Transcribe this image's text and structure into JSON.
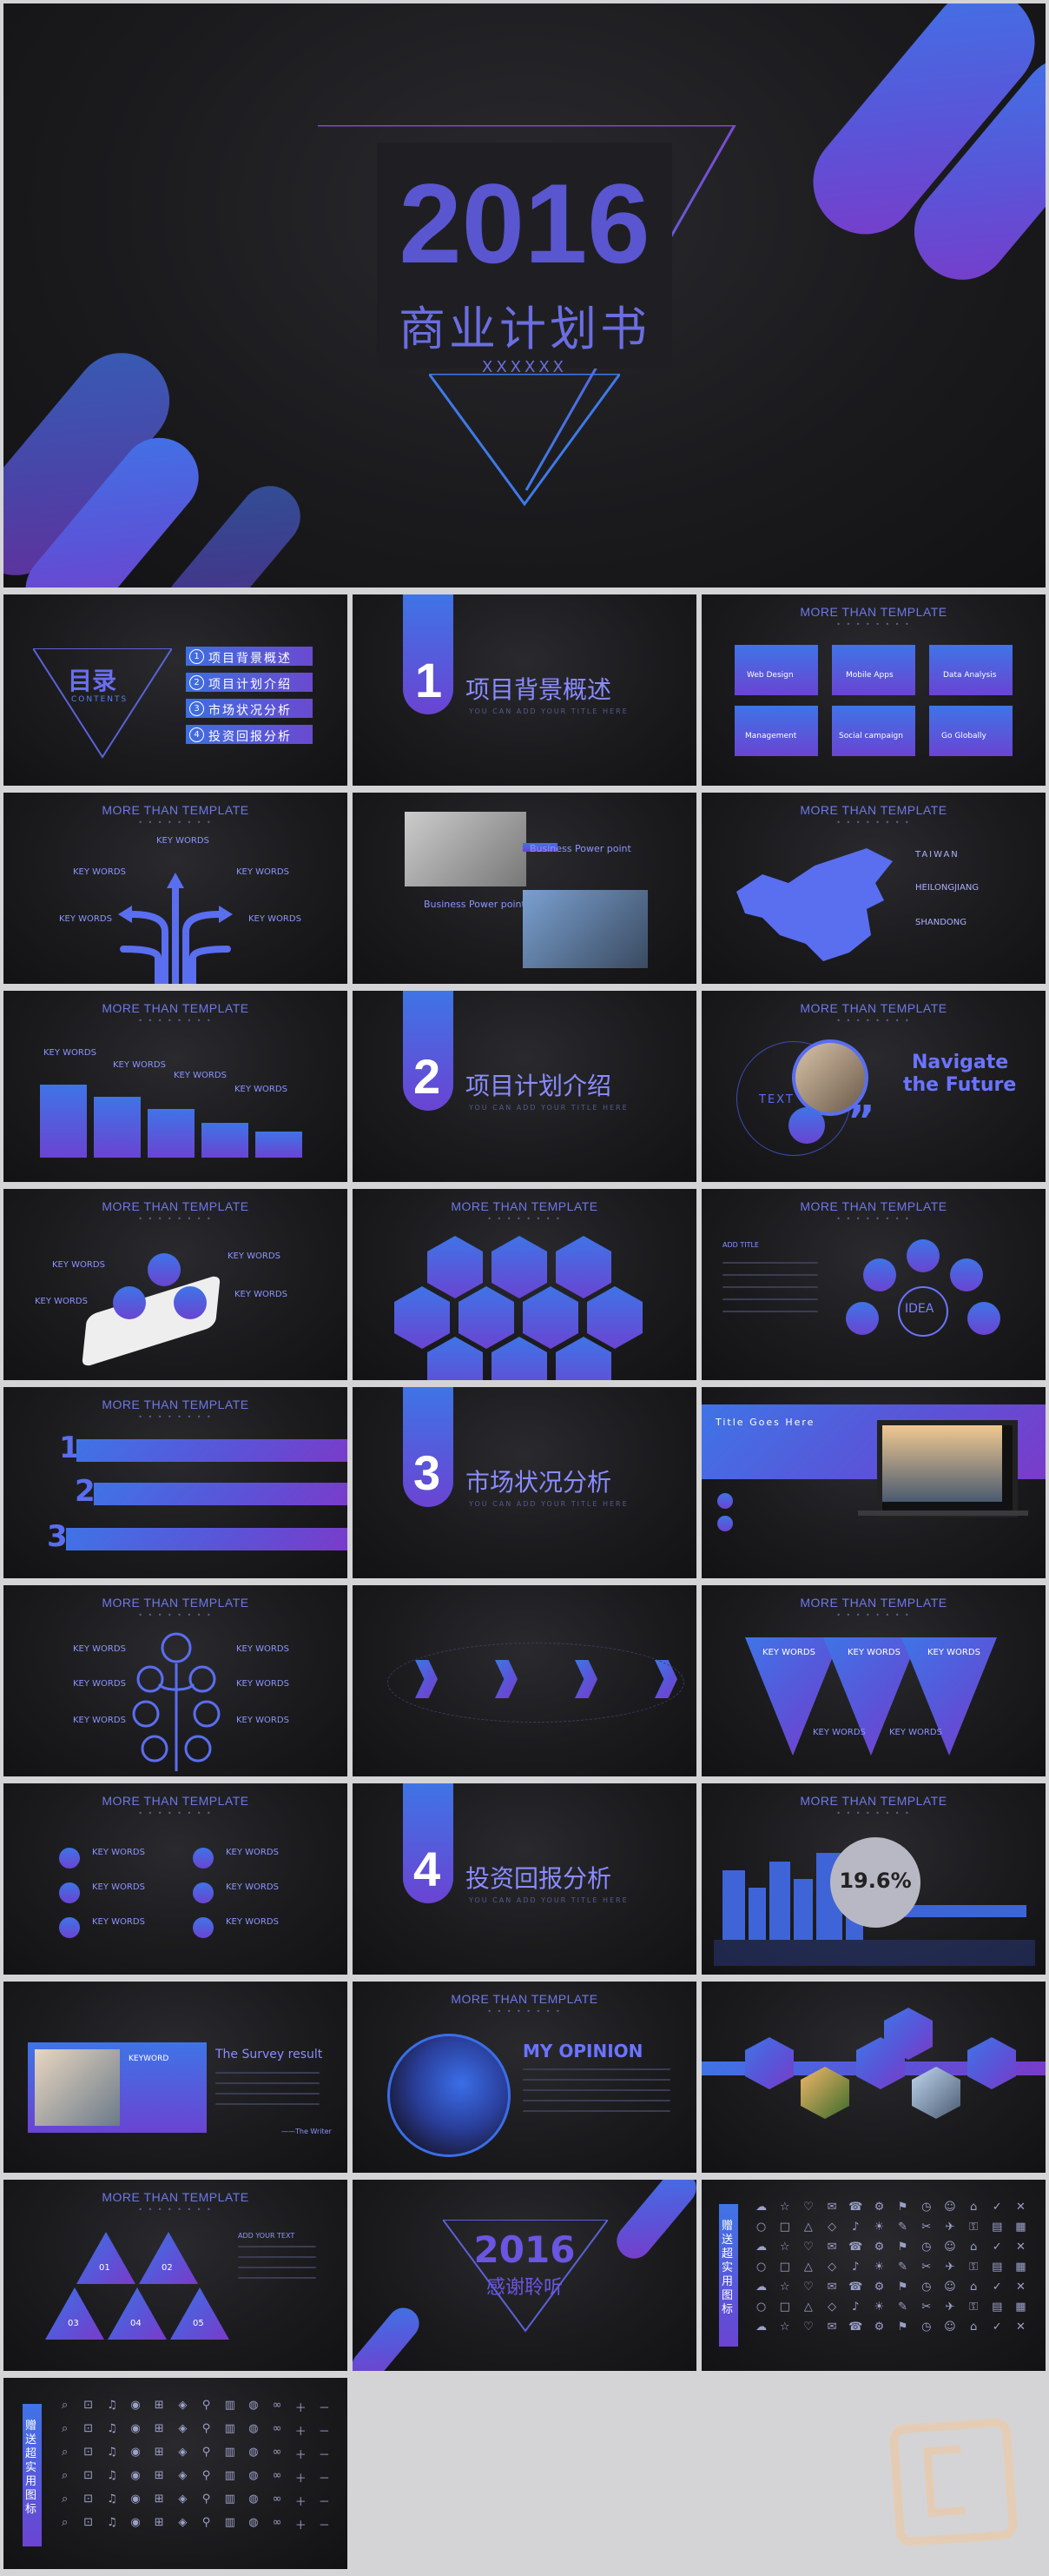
{
  "cover": {
    "year": "2016",
    "title": "商业计划书",
    "subtitle": "XXXXXX"
  },
  "common": {
    "slide_header": "MORE THAN TEMPLATE",
    "section_sub": "YOU CAN ADD YOUR TITLE HERE",
    "key_words": "KEY WORDS"
  },
  "toc": {
    "title": "目录",
    "title_en": "CONTENTS",
    "items": [
      "项目背景概述",
      "项目计划介绍",
      "市场状况分析",
      "投资回报分析"
    ]
  },
  "sections": [
    {
      "num": "1",
      "title": "项目背景概述"
    },
    {
      "num": "2",
      "title": "项目计划介绍"
    },
    {
      "num": "3",
      "title": "市场状况分析"
    },
    {
      "num": "4",
      "title": "投资回报分析"
    }
  ],
  "services": [
    "Web Design",
    "Mobile Apps",
    "Data Analysis",
    "Management",
    "Social campaign",
    "Go Globally"
  ],
  "business": [
    "Business Power point",
    "Business Power point"
  ],
  "map": {
    "regions": [
      "TAIWAN",
      "HEILONGJIANG",
      "SHANDONG"
    ]
  },
  "navigate": {
    "line1": "Navigate",
    "line2": "the Future",
    "text_label": "TEXT",
    "quote": "”"
  },
  "idea": {
    "center": "IDEA",
    "add_title": "ADD TITLE"
  },
  "steps": [
    "1",
    "2",
    "3"
  ],
  "laptop": {
    "title": "Title Goes Here"
  },
  "percent": "19.6%",
  "survey": {
    "title": "The Survey result",
    "keyword": "KEYWORD",
    "author": "——The Writer"
  },
  "opinion": "MY OPINION",
  "triangles": {
    "labels": [
      "01",
      "02",
      "03",
      "04",
      "05"
    ],
    "add_text": "ADD YOUR TEXT"
  },
  "thanks": {
    "year": "2016",
    "title": "感谢聆听"
  },
  "icon_sidebar": "赠送超实用图标"
}
